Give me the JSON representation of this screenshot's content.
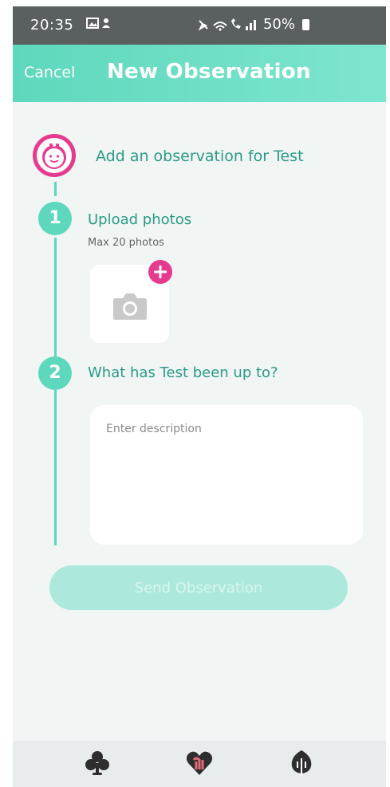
{
  "status_bar": {
    "time": "20:35",
    "battery": "50%"
  },
  "header": {
    "cancel_label": "Cancel",
    "title": "New Observation"
  },
  "observation": {
    "heading": "Add an observation for Test"
  },
  "steps": [
    {
      "number": "1",
      "title": "Upload photos",
      "subtitle": "Max 20 photos"
    },
    {
      "number": "2",
      "title": "What has Test been up to?"
    }
  ],
  "description": {
    "placeholder": "Enter description",
    "value": ""
  },
  "send_label": "Send Observation",
  "colors": {
    "accent": "#5ed8bc",
    "accent_text": "#2b9b87",
    "pink": "#e63a8f",
    "background": "#f1f5f4"
  },
  "tab_bar": {
    "icons": [
      "club-tree-icon",
      "heart-icon",
      "leaf-icon"
    ]
  }
}
